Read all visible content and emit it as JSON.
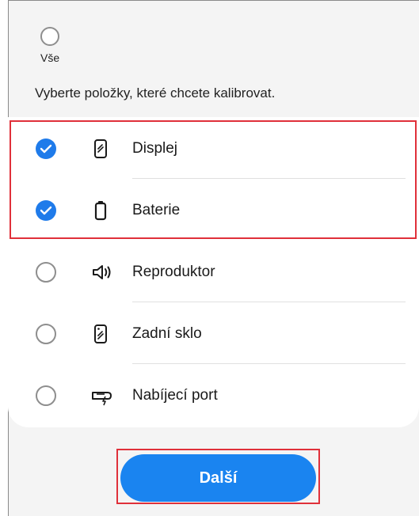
{
  "select_all": {
    "label": "Vše",
    "checked": false
  },
  "instruction": "Vyberte položky, které chcete kalibrovat.",
  "items": [
    {
      "label": "Displej",
      "icon": "phone-screen-icon",
      "checked": true
    },
    {
      "label": "Baterie",
      "icon": "battery-icon",
      "checked": true
    },
    {
      "label": "Reproduktor",
      "icon": "speaker-icon",
      "checked": false
    },
    {
      "label": "Zadní sklo",
      "icon": "back-glass-icon",
      "checked": false
    },
    {
      "label": "Nabíjecí port",
      "icon": "charging-port-icon",
      "checked": false
    }
  ],
  "next_button": {
    "label": "Další"
  },
  "colors": {
    "accent": "#1a84f0",
    "check": "#1f7bea",
    "highlight": "#e0303a"
  }
}
